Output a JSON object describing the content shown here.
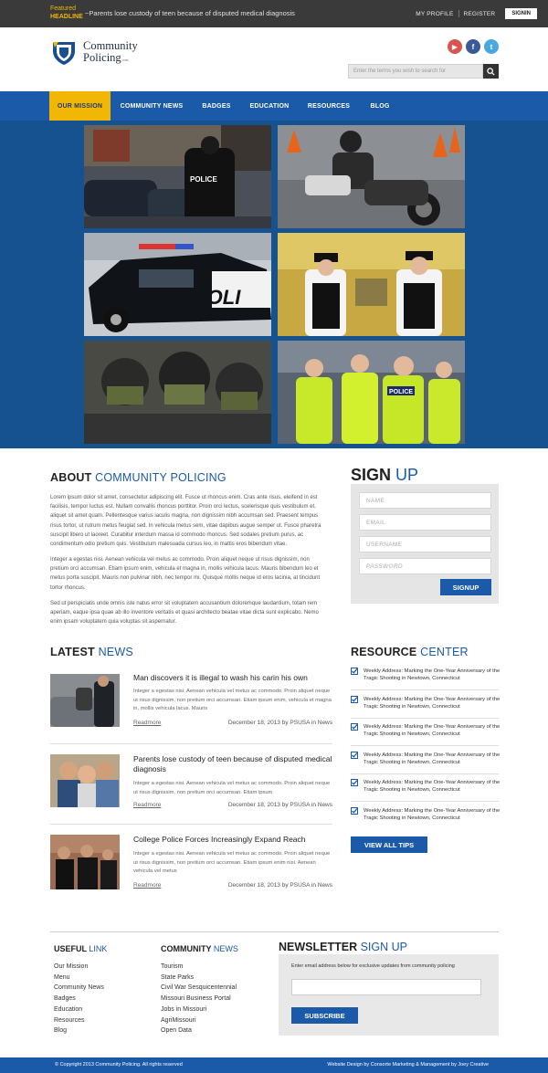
{
  "topbar": {
    "featured_label": "Featured",
    "headline_label": "HEADLINE",
    "headline_text": "~Parents lose custody of teen because of disputed medical diagnosis",
    "my_profile": "MY PROFILE",
    "register": "REGISTER",
    "signin": "SIGNIN"
  },
  "header": {
    "logo_line1": "Community",
    "logo_line2": "Policing",
    "logo_suffix": ".com",
    "social": [
      "youtube-icon",
      "facebook-icon",
      "twitter-icon"
    ],
    "search_placeholder": "Enter the terms you wish to search for"
  },
  "nav": {
    "items": [
      {
        "label": "OUR MISSION",
        "active": true
      },
      {
        "label": "COMMUNITY NEWS",
        "active": false
      },
      {
        "label": "BADGES",
        "active": false
      },
      {
        "label": "EDUCATION",
        "active": false
      },
      {
        "label": "RESOURCES",
        "active": false
      },
      {
        "label": "BLOG",
        "active": false
      }
    ]
  },
  "colors": {
    "primary_blue": "#1a5aa8",
    "accent_yellow": "#f2b705",
    "topbar_dark": "#3a3a3a"
  },
  "about": {
    "heading_a": "ABOUT",
    "heading_b": "COMMUNITY POLICING",
    "p1": "Lorem ipsum dolor sit amet, consectetur adipiscing elit. Fusce ut rhoncus enim. Cras ante risus, eleifend in est facilisis, tempor luctus est. Nullam convallis rhoncus porttitor. Proin orci lectus, scelerisque quis vestibulum et, aliquet sit amet quam. Pellentesque varius iaculis magna, non dignissim nibh accumsan sed. Praesent tempus risus tortor, ut rutrum metus feugiat sed. In vehicula metus sem, vitae dapibus augue semper ut. Fusce pharetra suscipit libero ut laoreet. Curabitur interdum massa id commodo rhoncus. Sed sodales pretium purus, ac condimentum odio pretium quis. Vestibulum malesuada cursus leo, in mattis eros bibendum vitae.",
    "p2": "Integer a egestas nisi. Aenean vehicula vel metus ac commodo. Proin aliquet neque ut risus dignissim, non pretium orci accumsan. Etiam ipsum enim, vehicula et magna in, mollis vehicula lacus. Mauris bibendum leo et metus porta suscipit. Mauris non pulvinar nibh, nec tempor mi. Quisque mollis neque id eros lacinia, at tincidunt tortor rhoncus.",
    "p3": "Sed ut perspiciatis unde omnis iste natus error sit voluptatem accusantium doloremque laudantium, totam rem aperiam, eaque ipsa quae ab illo inventore veritatis et quasi architecto beatae vitae dicta sunt explicabo. Nemo enim ipsam voluptatem quia voluptas sit aspernatur."
  },
  "signup": {
    "heading_a": "SIGN",
    "heading_b": "UP",
    "name_placeholder": "NAME",
    "email_placeholder": "EMAIL",
    "username_placeholder": "USERNAME",
    "password_placeholder": "PASSWORD",
    "button": "SIGNUP"
  },
  "news": {
    "heading_a": "LATEST",
    "heading_b": "NEWS",
    "items": [
      {
        "title": "Man discovers it is illegal to wash his carin his own",
        "body": "Integer a egestas nisi. Aenean vehicula vel metus ac commodo. Proin aliquet neque ut risus dignissim, non pretium orci accumsan. Etiam ipsum enim, vehicula et magna in, mollis vehicula lacus. Mauris",
        "readmore": "Readmore",
        "meta": "December 18, 2013 by PSUSA in News"
      },
      {
        "title": "Parents lose custody of teen because of disputed medical diagnosis",
        "body": "Integer a egestas nisi. Aenean vehicula vel metus ac commodo. Proin aliquet neque ut risus dignissim, non pretium orci accumsan. Etiam ipsum",
        "readmore": "Readmore",
        "meta": "December 18, 2013 by PSUSA in News"
      },
      {
        "title": "College Police Forces Increasingly Expand Reach",
        "body": "Integer a egestas nisi. Aenean vehicula vel metus ac commodo. Proin aliquet neque ut risus dignissim, non pretium orci accumsan. Etiam ipsum enim nisi. Aenean vehicula vel metus",
        "readmore": "Readmore",
        "meta": "December 18, 2013 by PSUSA in News"
      }
    ]
  },
  "resources": {
    "heading_a": "RESOURCE",
    "heading_b": "CENTER",
    "items": [
      "Weekly Address: Marking the One-Year Anniversary of the Tragic Shooting in Newtown, Connecticut",
      "Weekly Address: Marking the One-Year Anniversary of the Tragic Shooting in Newtown, Connecticut",
      "Weekly Address: Marking the One-Year Anniversary of the Tragic Shooting in Newtown, Connecticut",
      "Weekly Address: Marking the One-Year Anniversary of the Tragic Shooting in Newtown, Connecticut",
      "Weekly Address: Marking the One-Year Anniversary of the Tragic Shooting in Newtown, Connecticut",
      "Weekly Address: Marking the One-Year Anniversary of the Tragic Shooting in Newtown, Connecticut"
    ],
    "button": "VIEW ALL TIPS"
  },
  "footer": {
    "useful_a": "USEFUL",
    "useful_b": "LINK",
    "useful_links": [
      "Our Mission",
      "Menu",
      "Community News",
      "Badges",
      "Education",
      "Resources",
      "Blog"
    ],
    "community_a": "COMMUNITY",
    "community_b": "NEWS",
    "community_links": [
      "Tourism",
      "State Parks",
      "Civil War Sesquicentennial",
      "Missouri Business Portal",
      "Jobs in Missouri",
      "AgriMissouri",
      "Open Data"
    ],
    "newsletter_a": "NEWSLETTER",
    "newsletter_b": "SIGN UP",
    "newsletter_desc": "Enter email address below for exclusive updates from community policing",
    "subscribe": "SUBSCRIBE",
    "copyright": "© Copyright 2013 Community Policing. All rights reserved",
    "credit": "Website Design by Consorte Marketing & Management by Joey Creative"
  }
}
